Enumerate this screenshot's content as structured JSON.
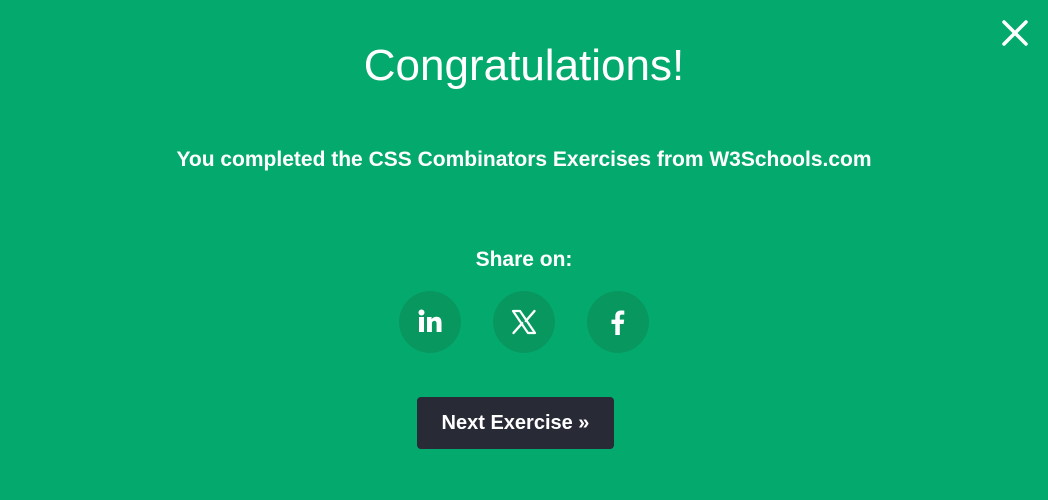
{
  "modal": {
    "background_color": "#04aa6d",
    "title": "Congratulations!",
    "message": "You completed the CSS Combinators Exercises from W3Schools.com",
    "close_icon": "close-icon"
  },
  "share": {
    "label": "Share on:",
    "buttons": [
      {
        "network": "LinkedIn",
        "icon": "linkedin-icon"
      },
      {
        "network": "X",
        "icon": "x-icon"
      },
      {
        "network": "Facebook",
        "icon": "facebook-icon"
      }
    ],
    "button_color": "#08985f"
  },
  "next": {
    "label": "Next Exercise »",
    "background_color": "#282a35"
  }
}
